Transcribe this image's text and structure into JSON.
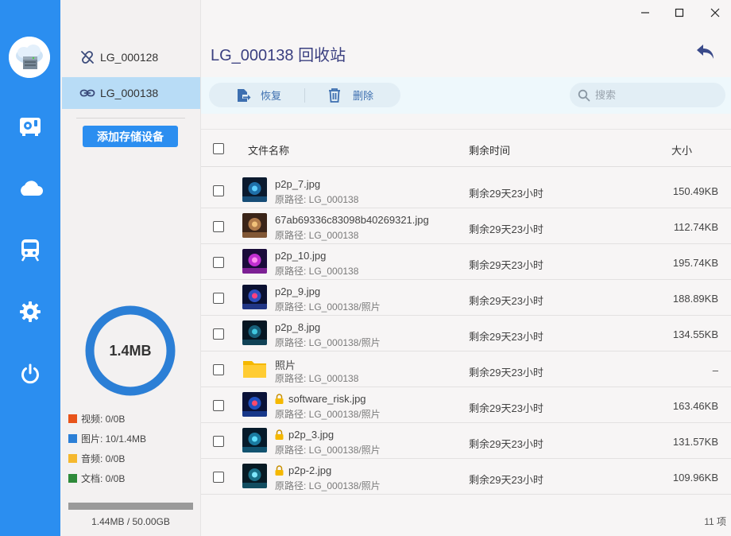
{
  "window": {
    "minimize_icon": "minimize-icon",
    "maximize_icon": "maximize-icon",
    "close_icon": "close-icon"
  },
  "rail": {
    "accent": "#2b8ef0",
    "items": [
      {
        "icon": "storage-device-icon"
      },
      {
        "icon": "cloud-icon"
      },
      {
        "icon": "train-icon"
      },
      {
        "icon": "gear-icon"
      },
      {
        "icon": "power-icon"
      }
    ]
  },
  "devices": {
    "items": [
      {
        "label": "LG_000128",
        "icon": "link-off-icon",
        "active": false
      },
      {
        "label": "LG_000138",
        "icon": "link-icon",
        "active": true
      }
    ],
    "add_button": "添加存储设备",
    "usage_total": "1.4MB",
    "legend": [
      {
        "label": "视频: 0/0B",
        "color": "#e8541a"
      },
      {
        "label": "图片: 10/1.4MB",
        "color": "#2b7fd6"
      },
      {
        "label": "音频: 0/0B",
        "color": "#f5b82e"
      },
      {
        "label": "文档: 0/0B",
        "color": "#2e8a3a"
      }
    ],
    "capacity_fraction": 3e-05,
    "capacity_text": "1.44MB / 50.00GB"
  },
  "main": {
    "title": "LG_000138 回收站",
    "restore_label": "恢复",
    "delete_label": "删除",
    "search_placeholder": "搜索",
    "columns": {
      "name": "文件名称",
      "remaining": "剩余时间",
      "size": "大小"
    },
    "rows": [
      {
        "name": "p2p_7.jpg",
        "path": "原路径: LG_000138",
        "remaining": "剩余29天23小时",
        "size": "150.49KB",
        "locked": false,
        "thumb": "image"
      },
      {
        "name": "67ab69336c83098b40269321.jpg",
        "path": "原路径: LG_000138",
        "remaining": "剩余29天23小时",
        "size": "112.74KB",
        "locked": false,
        "thumb": "image"
      },
      {
        "name": "p2p_10.jpg",
        "path": "原路径: LG_000138",
        "remaining": "剩余29天23小时",
        "size": "195.74KB",
        "locked": false,
        "thumb": "image"
      },
      {
        "name": "p2p_9.jpg",
        "path": "原路径: LG_000138/照片",
        "remaining": "剩余29天23小时",
        "size": "188.89KB",
        "locked": false,
        "thumb": "image"
      },
      {
        "name": "p2p_8.jpg",
        "path": "原路径: LG_000138/照片",
        "remaining": "剩余29天23小时",
        "size": "134.55KB",
        "locked": false,
        "thumb": "image"
      },
      {
        "name": "照片",
        "path": "原路径: LG_000138",
        "remaining": "剩余29天23小时",
        "size": "–",
        "locked": false,
        "thumb": "folder"
      },
      {
        "name": "software_risk.jpg",
        "path": "原路径: LG_000138/照片",
        "remaining": "剩余29天23小时",
        "size": "163.46KB",
        "locked": true,
        "thumb": "image"
      },
      {
        "name": "p2p_3.jpg",
        "path": "原路径: LG_000138/照片",
        "remaining": "剩余29天23小时",
        "size": "131.57KB",
        "locked": true,
        "thumb": "image"
      },
      {
        "name": "p2p-2.jpg",
        "path": "原路径: LG_000138/照片",
        "remaining": "剩余29天23小时",
        "size": "109.96KB",
        "locked": true,
        "thumb": "image"
      }
    ],
    "item_count": "11 项"
  }
}
